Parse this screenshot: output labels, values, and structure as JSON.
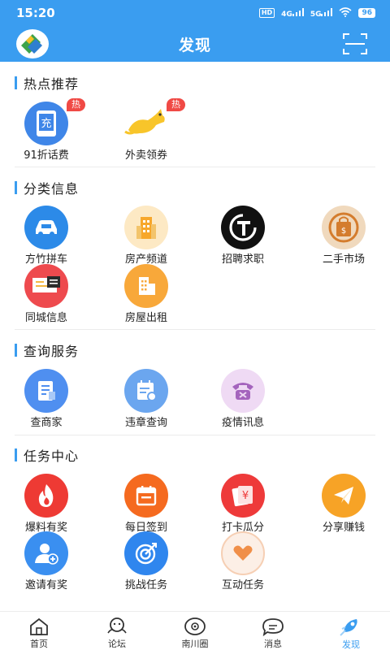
{
  "status": {
    "time": "15:20",
    "net1": "HD",
    "net2": "4G",
    "net3": "5G",
    "battery": "96"
  },
  "header": {
    "title": "发现"
  },
  "sections": {
    "hot": {
      "title": "热点推荐",
      "items": [
        {
          "label": "91折话费",
          "badge": "热",
          "icon": "phone-recharge-icon",
          "glyph": "充"
        },
        {
          "label": "外卖领券",
          "badge": "热",
          "icon": "kangaroo-delivery-icon"
        }
      ]
    },
    "category": {
      "title": "分类信息",
      "items": [
        {
          "label": "方竹拼车",
          "icon": "carpool-car-icon"
        },
        {
          "label": "房产频道",
          "icon": "real-estate-building-icon"
        },
        {
          "label": "招聘求职",
          "icon": "job-recruit-icon"
        },
        {
          "label": "二手市场",
          "icon": "second-hand-bag-icon"
        },
        {
          "label": "同城信息",
          "icon": "local-info-board-icon"
        },
        {
          "label": "房屋出租",
          "icon": "house-rent-icon"
        }
      ]
    },
    "query": {
      "title": "查询服务",
      "items": [
        {
          "label": "查商家",
          "icon": "merchant-doc-icon"
        },
        {
          "label": "违章查询",
          "icon": "traffic-violation-calendar-icon"
        },
        {
          "label": "疫情讯息",
          "icon": "epidemic-phone-icon"
        }
      ]
    },
    "task": {
      "title": "任务中心",
      "items": [
        {
          "label": "爆料有奖",
          "icon": "flame-icon"
        },
        {
          "label": "每日签到",
          "icon": "calendar-checkin-icon"
        },
        {
          "label": "打卡瓜分",
          "icon": "yuan-cards-icon",
          "glyph": "¥"
        },
        {
          "label": "分享赚钱",
          "icon": "paper-plane-icon"
        },
        {
          "label": "邀请有奖",
          "icon": "invite-user-icon"
        },
        {
          "label": "挑战任务",
          "icon": "target-icon"
        },
        {
          "label": "互动任务",
          "icon": "heart-chat-icon"
        }
      ]
    }
  },
  "tabbar": [
    {
      "label": "首页",
      "icon": "home-icon"
    },
    {
      "label": "论坛",
      "icon": "forum-icon"
    },
    {
      "label": "南川圈",
      "icon": "circle-eye-icon"
    },
    {
      "label": "消息",
      "icon": "message-icon"
    },
    {
      "label": "发现",
      "icon": "discover-icon",
      "active": true
    }
  ],
  "colors": {
    "primary": "#3a9df0",
    "hot_badge": "#f04a45"
  }
}
